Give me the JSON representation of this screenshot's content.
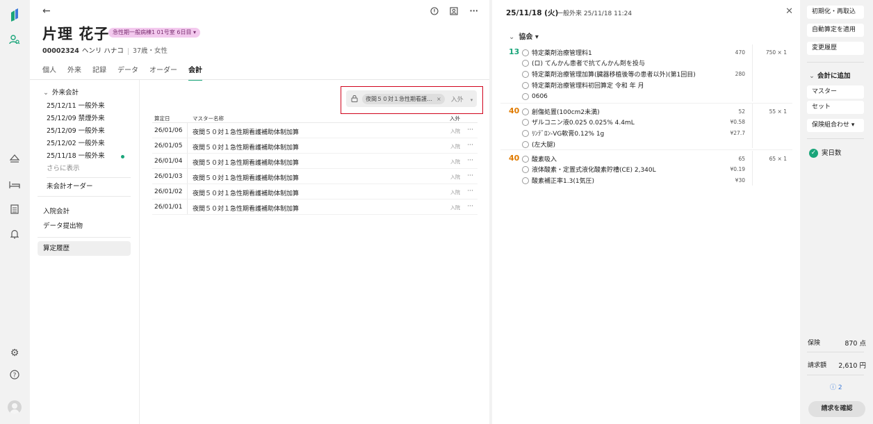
{
  "patient": {
    "name": "片理 花子",
    "ward_badge": "急性期一般病棟1 01号室 6日目 ▾",
    "id": "00002324",
    "kana": "ヘンリ ハナコ",
    "age_sex": "37歳・女性"
  },
  "tabs": [
    "個人",
    "外来",
    "記録",
    "データ",
    "オーダー",
    "会計"
  ],
  "active_tab": "会計",
  "leftnav": {
    "section_outpatient": "外来会計",
    "outpatient_items": [
      "25/12/11 一般外来",
      "25/12/09 禁煙外来",
      "25/12/09 一般外来",
      "25/12/02 一般外来",
      "25/11/18 一般外来"
    ],
    "show_more": "さらに表示",
    "unbilled_orders": "未会計オーダー",
    "inpatient_billing": "入院会計",
    "data_submission": "データ提出物",
    "calculation_history": "算定履歴"
  },
  "filter": {
    "chip_label": "夜間５０対１急性期看護…",
    "chip_remove": "×",
    "select_value": "入外",
    "select_caret": "▾"
  },
  "table": {
    "headers": {
      "date": "算定日",
      "master": "マスター名称",
      "io": "入外"
    },
    "rows": [
      {
        "date": "26/01/06",
        "name": "夜間５０対１急性期看護補助体制加算",
        "io": "入院",
        "more": "···"
      },
      {
        "date": "26/01/05",
        "name": "夜間５０対１急性期看護補助体制加算",
        "io": "入院",
        "more": "···"
      },
      {
        "date": "26/01/04",
        "name": "夜間５０対１急性期看護補助体制加算",
        "io": "入院",
        "more": "···"
      },
      {
        "date": "26/01/03",
        "name": "夜間５０対１急性期看護補助体制加算",
        "io": "入院",
        "more": "···"
      },
      {
        "date": "26/01/02",
        "name": "夜間５０対１急性期看護補助体制加算",
        "io": "入院",
        "more": "···"
      },
      {
        "date": "26/01/01",
        "name": "夜間５０対１急性期看護補助体制加算",
        "io": "入院",
        "more": "···"
      }
    ]
  },
  "detail": {
    "date": "25/11/18 (火)",
    "subtitle": "一般外来 25/11/18 11:24",
    "close": "✕",
    "association": "協会 ▾",
    "groups": [
      {
        "num": "13",
        "color": "#1aa57a",
        "lines": [
          "特定薬剤治療管理料1",
          "(ロ) てんかん患者で抗てんかん剤を投与",
          "特定薬剤治療管理加算(臓器移植後等の患者以外)(第1回目)",
          "特定薬剤治療管理料初回算定 令和 年 月",
          "0606"
        ],
        "line_points": [
          "470",
          "",
          "280",
          "",
          ""
        ],
        "total": "750 × 1"
      },
      {
        "num": "40",
        "color": "#e07b00",
        "lines": [
          "創傷処置(100cm2未満)",
          "ザルコニン液0.025 0.025%  4.4mL",
          "ﾘﾝﾃﾞﾛﾝ-VG軟膏0.12%  1g",
          "(左大腿)"
        ],
        "line_points": [
          "52",
          "¥0.58",
          "¥27.7",
          ""
        ],
        "total": "55 × 1"
      },
      {
        "num": "40",
        "color": "#e07b00",
        "lines": [
          "酸素吸入",
          "液体酸素・定置式液化酸素貯槽(CE)  2,340L",
          "酸素補正率1.3(1気圧)"
        ],
        "line_points": [
          "65",
          "¥0.19",
          "¥30"
        ],
        "total": "65 × 1"
      }
    ]
  },
  "sidepanel": {
    "reset_recalc": "初期化・再取込",
    "apply_auto": "自動算定を適用",
    "change_history": "変更履歴",
    "add_to_billing": "会計に追加",
    "master": "マスター",
    "set": "セット",
    "insurance_combo": "保険組合わせ ▾",
    "actual_days": "実日数",
    "insurance_label": "保険",
    "insurance_points": "870 点",
    "billing_label": "請求額",
    "billing_amount": "2,610 円",
    "notice": "ⓘ 2",
    "confirm": "請求を確認"
  },
  "colors": {
    "accent": "#1aa57a",
    "badge_bg": "#f3c9ee",
    "highlight_border": "#d0021b",
    "points_orange": "#e07b00"
  }
}
